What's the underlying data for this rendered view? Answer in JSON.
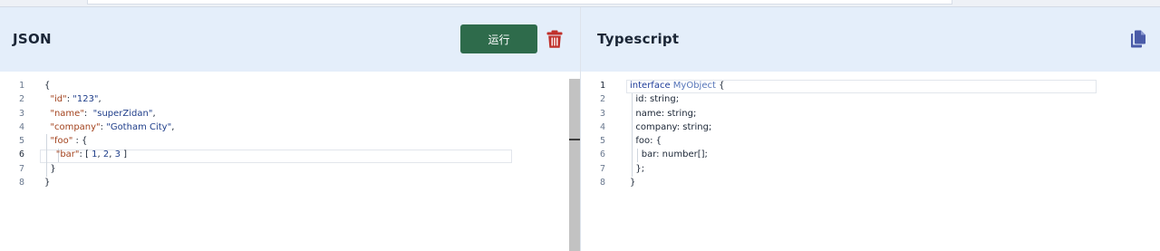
{
  "json_pane": {
    "title": "JSON",
    "run_label": "运行",
    "active_line": 6,
    "line_numbers": [
      "1",
      "2",
      "3",
      "4",
      "5",
      "6",
      "7",
      "8"
    ],
    "lines": [
      [
        {
          "t": "{",
          "c": ""
        }
      ],
      [
        {
          "t": "  ",
          "c": ""
        },
        {
          "t": "\"id\"",
          "c": "key"
        },
        {
          "t": ": ",
          "c": ""
        },
        {
          "t": "\"123\"",
          "c": "str"
        },
        {
          "t": ",",
          "c": ""
        }
      ],
      [
        {
          "t": "  ",
          "c": ""
        },
        {
          "t": "\"name\"",
          "c": "key"
        },
        {
          "t": ":  ",
          "c": ""
        },
        {
          "t": "\"superZidan\"",
          "c": "str"
        },
        {
          "t": ",",
          "c": ""
        }
      ],
      [
        {
          "t": "  ",
          "c": ""
        },
        {
          "t": "\"company\"",
          "c": "key"
        },
        {
          "t": ": ",
          "c": ""
        },
        {
          "t": "\"Gotham City\"",
          "c": "str"
        },
        {
          "t": ",",
          "c": ""
        }
      ],
      [
        {
          "t": "  ",
          "c": ""
        },
        {
          "t": "\"foo\"",
          "c": "key"
        },
        {
          "t": " : {",
          "c": ""
        }
      ],
      [
        {
          "t": "    ",
          "c": ""
        },
        {
          "t": "\"bar\"",
          "c": "key"
        },
        {
          "t": ": [ ",
          "c": ""
        },
        {
          "t": "1",
          "c": "num"
        },
        {
          "t": ", ",
          "c": ""
        },
        {
          "t": "2",
          "c": "num"
        },
        {
          "t": ", ",
          "c": ""
        },
        {
          "t": "3",
          "c": "num"
        },
        {
          "t": " ]",
          "c": ""
        }
      ],
      [
        {
          "t": "  }",
          "c": ""
        }
      ],
      [
        {
          "t": "}",
          "c": ""
        }
      ]
    ]
  },
  "ts_pane": {
    "title": "Typescript",
    "active_line": 1,
    "line_numbers": [
      "1",
      "2",
      "3",
      "4",
      "5",
      "6",
      "7",
      "8"
    ],
    "lines": [
      [
        {
          "t": "interface",
          "c": "kw"
        },
        {
          "t": " ",
          "c": ""
        },
        {
          "t": "MyObject",
          "c": "type"
        },
        {
          "t": " {",
          "c": ""
        }
      ],
      [
        {
          "t": "  id: string;",
          "c": ""
        }
      ],
      [
        {
          "t": "  name: string;",
          "c": ""
        }
      ],
      [
        {
          "t": "  company: string;",
          "c": ""
        }
      ],
      [
        {
          "t": "  foo: {",
          "c": ""
        }
      ],
      [
        {
          "t": "    bar: number[];",
          "c": ""
        }
      ],
      [
        {
          "t": "  };",
          "c": ""
        }
      ],
      [
        {
          "t": "}",
          "c": ""
        }
      ]
    ]
  },
  "icons": {
    "delete": "trash-icon",
    "copy": "copy-icon"
  },
  "colors": {
    "header_bg": "#e4eefa",
    "run_button": "#2e6b4b",
    "trash": "#c0302b",
    "copy": "#4a5ba8"
  }
}
